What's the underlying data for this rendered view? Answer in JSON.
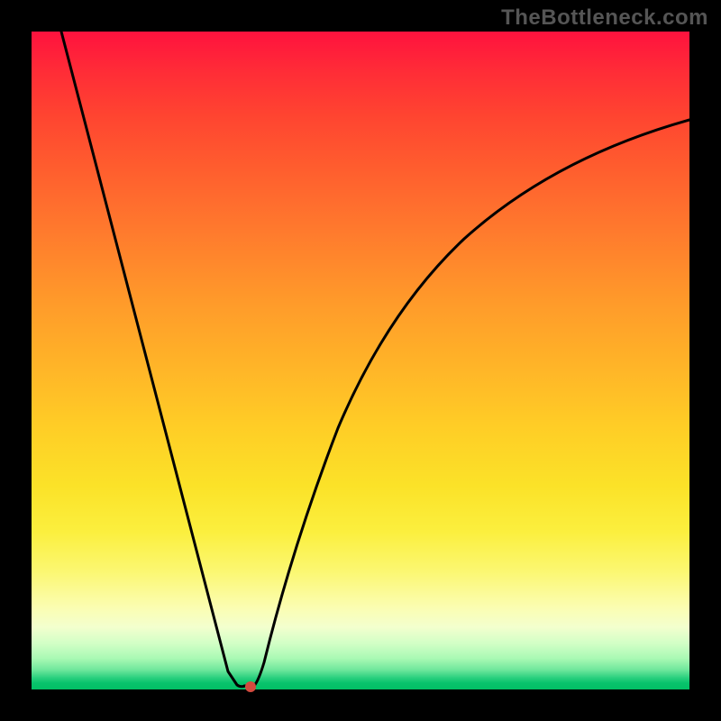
{
  "watermark": "TheBottleneck.com",
  "colors": {
    "background": "#000000",
    "gradient_top": "#ff123e",
    "gradient_mid": "#ffcd26",
    "gradient_bottom": "#02bf65",
    "curve_stroke": "#000000",
    "min_marker": "#d44a3e"
  },
  "chart_data": {
    "type": "line",
    "title": "",
    "xlabel": "",
    "ylabel": "",
    "xlim": [
      0,
      100
    ],
    "ylim": [
      0,
      100
    ],
    "series": [
      {
        "name": "bottleneck-curve",
        "x": [
          4.5,
          10,
          15,
          20,
          25,
          30,
          31.2,
          33.2,
          33.8,
          34,
          35,
          36,
          38,
          42,
          46.5,
          52,
          58,
          65.5,
          73,
          80,
          90,
          100
        ],
        "values": [
          100,
          78,
          59.5,
          40.5,
          21.5,
          2.7,
          0.6,
          0.5,
          0.5,
          0.6,
          4,
          9.5,
          18,
          30,
          39.5,
          49,
          57,
          64,
          70,
          75,
          81.5,
          87
        ]
      }
    ],
    "annotations": [
      {
        "name": "minimum",
        "x": 33.3,
        "y": 0.4
      }
    ]
  }
}
